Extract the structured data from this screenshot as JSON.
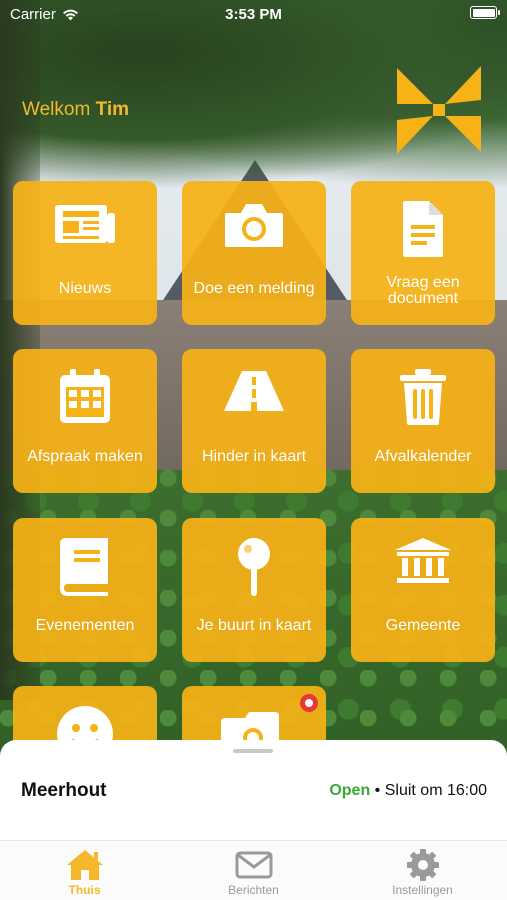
{
  "status_bar": {
    "carrier": "Carrier",
    "time": "3:53 PM"
  },
  "welcome": {
    "greeting": "Welkom",
    "name": "Tim"
  },
  "accent_color": "#F6B217",
  "tiles": [
    {
      "label": "Nieuws",
      "icon": "newspaper-icon"
    },
    {
      "label": "Doe een melding",
      "icon": "camera-icon"
    },
    {
      "label": "Vraag een document",
      "icon": "document-icon"
    },
    {
      "label": "Afspraak maken",
      "icon": "calendar-icon"
    },
    {
      "label": "Hinder in kaart",
      "icon": "road-icon"
    },
    {
      "label": "Afvalkalender",
      "icon": "trash-icon"
    },
    {
      "label": "Evenementen",
      "icon": "book-icon"
    },
    {
      "label": "Je buurt in kaart",
      "icon": "map-pin-icon"
    },
    {
      "label": "Gemeente",
      "icon": "town-hall-icon"
    },
    {
      "label": "",
      "icon": "smiley-icon"
    },
    {
      "label": "",
      "icon": "photo-folder-icon"
    }
  ],
  "info": {
    "place": "Meerhout",
    "status": "Open",
    "closing": "• Sluit om 16:00"
  },
  "tabs": [
    {
      "label": "Thuis",
      "icon": "home-icon",
      "active": true
    },
    {
      "label": "Berichten",
      "icon": "mail-icon",
      "active": false
    },
    {
      "label": "Instellingen",
      "icon": "gear-icon",
      "active": false
    }
  ]
}
